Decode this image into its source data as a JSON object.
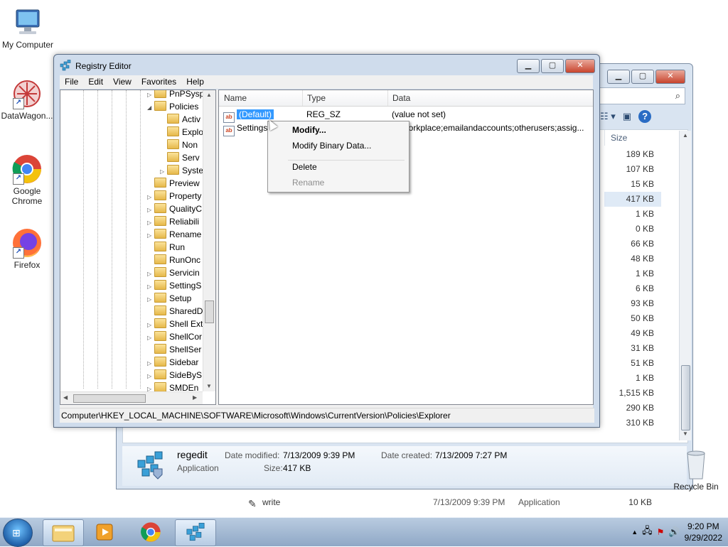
{
  "desktop": {
    "icons": [
      {
        "label": "My Computer"
      },
      {
        "label": "DataWagon..."
      },
      {
        "label": "Google Chrome"
      },
      {
        "label": "Firefox"
      },
      {
        "label": "Recycle Bin"
      }
    ]
  },
  "explorer": {
    "size_header": "Size",
    "sizes": [
      "189 KB",
      "107 KB",
      "15 KB",
      "417 KB",
      "1 KB",
      "0 KB",
      "66 KB",
      "48 KB",
      "1 KB",
      "6 KB",
      "93 KB",
      "50 KB",
      "49 KB",
      "31 KB",
      "51 KB",
      "1 KB",
      "1,515 KB",
      "290 KB",
      "310 KB"
    ],
    "write_row": {
      "name": "write",
      "date": "7/13/2009 9:39 PM",
      "type": "Application",
      "size": "10 KB"
    },
    "details": {
      "name": "regedit",
      "kind": "Application",
      "date_modified_label": "Date modified:",
      "date_modified": "7/13/2009 9:39 PM",
      "date_created_label": "Date created:",
      "date_created": "7/13/2009 7:27 PM",
      "size_label": "Size:",
      "size": "417 KB"
    }
  },
  "regedit": {
    "title": "Registry Editor",
    "menu": [
      "File",
      "Edit",
      "View",
      "Favorites",
      "Help"
    ],
    "tree": [
      {
        "label": "PnPSysp",
        "indent": 1,
        "expander": "▷"
      },
      {
        "label": "Policies",
        "indent": 1,
        "expander": "◢"
      },
      {
        "label": "Activ",
        "indent": 2,
        "expander": ""
      },
      {
        "label": "Explo",
        "indent": 2,
        "expander": ""
      },
      {
        "label": "Non",
        "indent": 2,
        "expander": ""
      },
      {
        "label": "Serv",
        "indent": 2,
        "expander": ""
      },
      {
        "label": "Syste",
        "indent": 2,
        "expander": "▷"
      },
      {
        "label": "Preview",
        "indent": 1,
        "expander": ""
      },
      {
        "label": "Property",
        "indent": 1,
        "expander": "▷"
      },
      {
        "label": "QualityC",
        "indent": 1,
        "expander": "▷"
      },
      {
        "label": "Reliabili",
        "indent": 1,
        "expander": "▷"
      },
      {
        "label": "Rename",
        "indent": 1,
        "expander": "▷"
      },
      {
        "label": "Run",
        "indent": 1,
        "expander": ""
      },
      {
        "label": "RunOnc",
        "indent": 1,
        "expander": ""
      },
      {
        "label": "Servicin",
        "indent": 1,
        "expander": "▷"
      },
      {
        "label": "SettingS",
        "indent": 1,
        "expander": "▷"
      },
      {
        "label": "Setup",
        "indent": 1,
        "expander": "▷"
      },
      {
        "label": "SharedD",
        "indent": 1,
        "expander": ""
      },
      {
        "label": "Shell Ext",
        "indent": 1,
        "expander": "▷"
      },
      {
        "label": "ShellCor",
        "indent": 1,
        "expander": "▷"
      },
      {
        "label": "ShellSer",
        "indent": 1,
        "expander": ""
      },
      {
        "label": "Sidebar",
        "indent": 1,
        "expander": "▷"
      },
      {
        "label": "SideByS",
        "indent": 1,
        "expander": "▷"
      },
      {
        "label": "SMDEn",
        "indent": 1,
        "expander": "▷"
      }
    ],
    "columns": {
      "name": "Name",
      "type": "Type",
      "data": "Data"
    },
    "rows": [
      {
        "name": "(Default)",
        "type": "REG_SZ",
        "data": "(value not set)"
      },
      {
        "name": "Settings",
        "type": "",
        "data": "workplace;emailandaccounts;otherusers;assig..."
      }
    ],
    "status_path": "Computer\\HKEY_LOCAL_MACHINE\\SOFTWARE\\Microsoft\\Windows\\CurrentVersion\\Policies\\Explorer",
    "context_menu": {
      "modify": "Modify...",
      "modify_binary": "Modify Binary Data...",
      "delete": "Delete",
      "rename": "Rename"
    },
    "tree_scroll_label": "⦙⦙⦙"
  },
  "taskbar": {
    "time": "9:20 PM",
    "date": "9/29/2022"
  }
}
